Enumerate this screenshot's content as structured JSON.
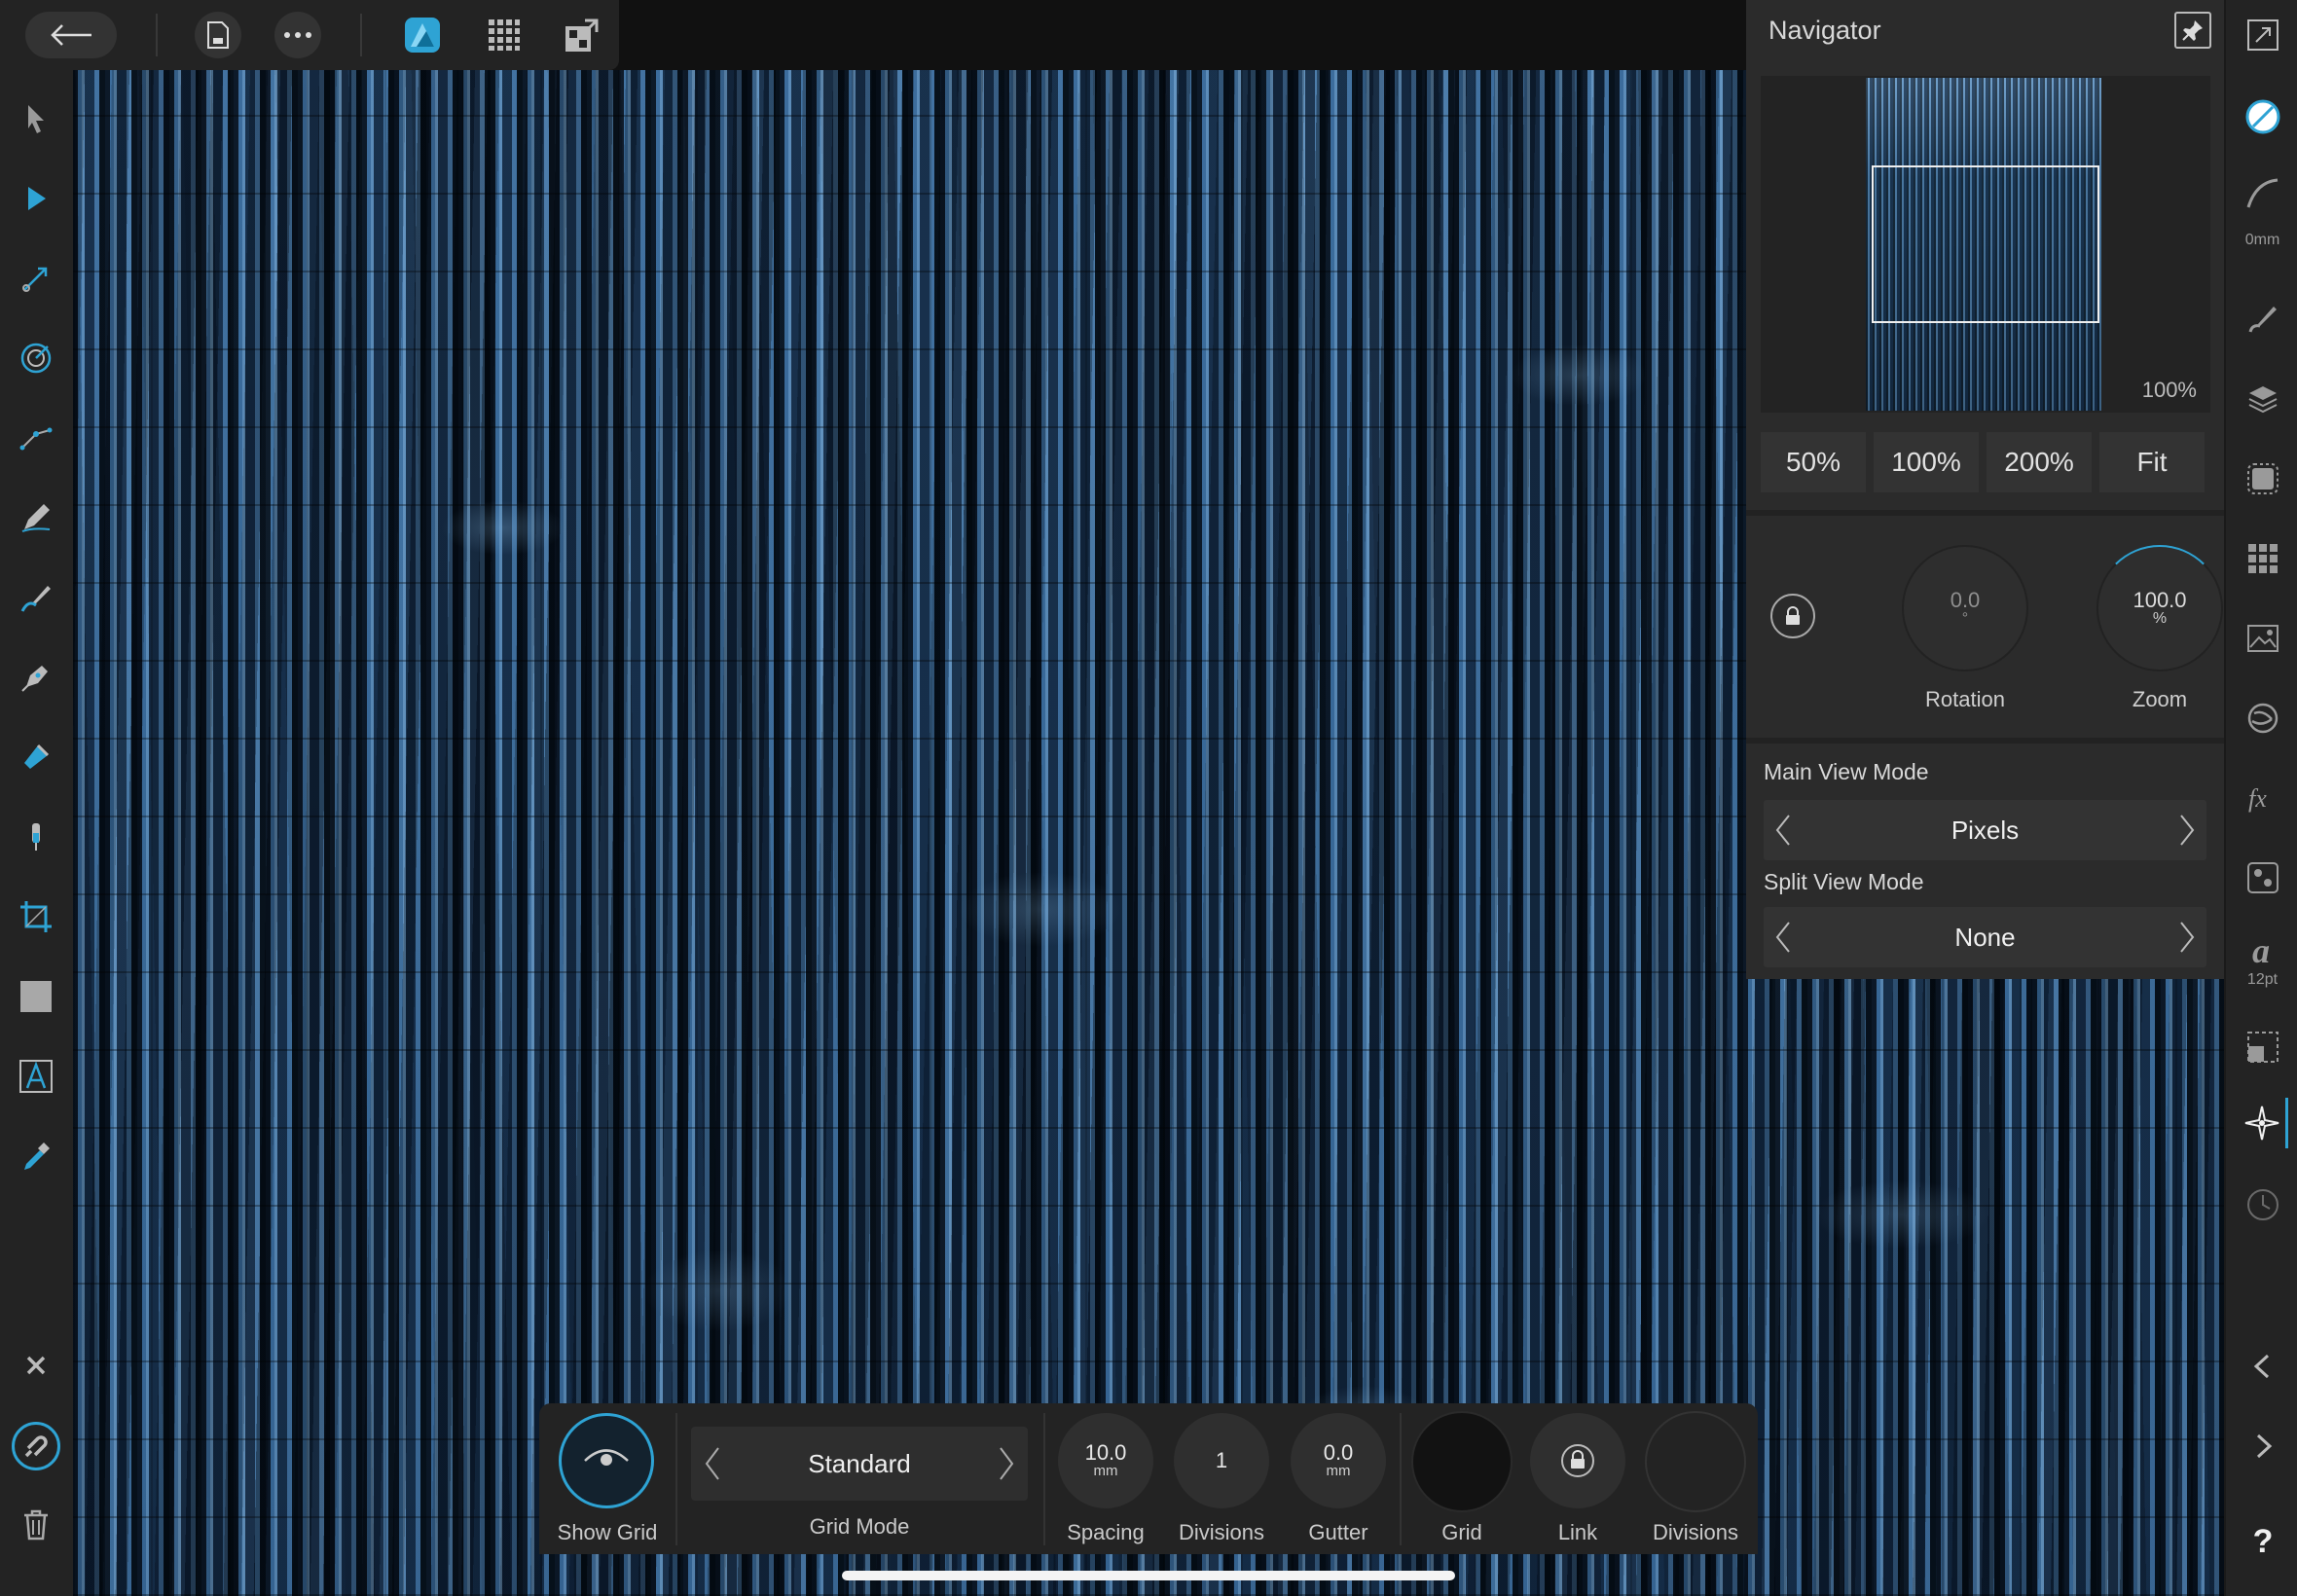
{
  "navigator": {
    "title": "Navigator",
    "preview_zoom_label": "100%",
    "zoom_presets": [
      "50%",
      "100%",
      "200%",
      "Fit"
    ],
    "rotation": {
      "value": "0.0",
      "unit": "°",
      "label": "Rotation"
    },
    "zoom": {
      "value": "100.0",
      "unit": "%",
      "label": "Zoom"
    },
    "main_view_mode": {
      "label": "Main View Mode",
      "value": "Pixels"
    },
    "split_view_mode": {
      "label": "Split View Mode",
      "value": "None"
    }
  },
  "right_studio": {
    "stroke_width_caption": "0mm",
    "text_size_caption": "12pt",
    "help_label": "?"
  },
  "grid_toolbar": {
    "show_grid_label": "Show Grid",
    "grid_mode": {
      "label": "Grid Mode",
      "value": "Standard"
    },
    "spacing": {
      "value": "10.0",
      "unit": "mm",
      "label": "Spacing"
    },
    "divisions": {
      "value": "1",
      "label": "Divisions"
    },
    "gutter": {
      "value": "0.0",
      "unit": "mm",
      "label": "Gutter"
    },
    "grid_color_label": "Grid",
    "link_label": "Link",
    "divisions_color_label": "Divisions"
  },
  "colors": {
    "accent": "#2ea3d4",
    "panel": "#2b2b2b",
    "toolbar": "#232323"
  }
}
